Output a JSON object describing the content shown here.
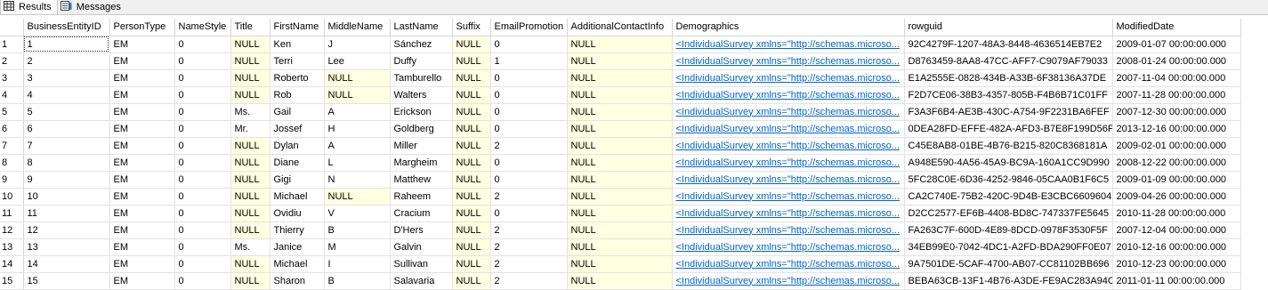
{
  "tabs": [
    {
      "label": "Results",
      "icon": "grid-icon",
      "active": true
    },
    {
      "label": "Messages",
      "icon": "messages-icon",
      "active": false
    }
  ],
  "columns": [
    "",
    "BusinessEntityID",
    "PersonType",
    "NameStyle",
    "Title",
    "FirstName",
    "MiddleName",
    "LastName",
    "Suffix",
    "EmailPromotion",
    "AdditionalContactInfo",
    "Demographics",
    "rowguid",
    "ModifiedDate"
  ],
  "null_color": "#ffffe1",
  "link_color": "#0066cc",
  "rows": [
    [
      "1",
      "1",
      "EM",
      "0",
      "NULL",
      "Ken",
      "J",
      "Sánchez",
      "NULL",
      "0",
      "NULL",
      "<IndividualSurvey xmlns=\"http://schemas.microso...",
      "92C4279F-1207-48A3-8448-4636514EB7E2",
      "2009-01-07 00:00:00.000"
    ],
    [
      "2",
      "2",
      "EM",
      "0",
      "NULL",
      "Terri",
      "Lee",
      "Duffy",
      "NULL",
      "1",
      "NULL",
      "<IndividualSurvey xmlns=\"http://schemas.microso...",
      "D8763459-8AA8-47CC-AFF7-C9079AF79033",
      "2008-01-24 00:00:00.000"
    ],
    [
      "3",
      "3",
      "EM",
      "0",
      "NULL",
      "Roberto",
      "NULL",
      "Tamburello",
      "NULL",
      "0",
      "NULL",
      "<IndividualSurvey xmlns=\"http://schemas.microso...",
      "E1A2555E-0828-434B-A33B-6F38136A37DE",
      "2007-11-04 00:00:00.000"
    ],
    [
      "4",
      "4",
      "EM",
      "0",
      "NULL",
      "Rob",
      "NULL",
      "Walters",
      "NULL",
      "0",
      "NULL",
      "<IndividualSurvey xmlns=\"http://schemas.microso...",
      "F2D7CE06-38B3-4357-805B-F4B6B71C01FF",
      "2007-11-28 00:00:00.000"
    ],
    [
      "5",
      "5",
      "EM",
      "0",
      "Ms.",
      "Gail",
      "A",
      "Erickson",
      "NULL",
      "0",
      "NULL",
      "<IndividualSurvey xmlns=\"http://schemas.microso...",
      "F3A3F6B4-AE3B-430C-A754-9F2231BA6FEF",
      "2007-12-30 00:00:00.000"
    ],
    [
      "6",
      "6",
      "EM",
      "0",
      "Mr.",
      "Jossef",
      "H",
      "Goldberg",
      "NULL",
      "0",
      "NULL",
      "<IndividualSurvey xmlns=\"http://schemas.microso...",
      "0DEA28FD-EFFE-482A-AFD3-B7E8F199D56F",
      "2013-12-16 00:00:00.000"
    ],
    [
      "7",
      "7",
      "EM",
      "0",
      "NULL",
      "Dylan",
      "A",
      "Miller",
      "NULL",
      "2",
      "NULL",
      "<IndividualSurvey xmlns=\"http://schemas.microso...",
      "C45E8AB8-01BE-4B76-B215-820C8368181A",
      "2009-02-01 00:00:00.000"
    ],
    [
      "8",
      "8",
      "EM",
      "0",
      "NULL",
      "Diane",
      "L",
      "Margheim",
      "NULL",
      "0",
      "NULL",
      "<IndividualSurvey xmlns=\"http://schemas.microso...",
      "A948E590-4A56-45A9-BC9A-160A1CC9D990",
      "2008-12-22 00:00:00.000"
    ],
    [
      "9",
      "9",
      "EM",
      "0",
      "NULL",
      "Gigi",
      "N",
      "Matthew",
      "NULL",
      "0",
      "NULL",
      "<IndividualSurvey xmlns=\"http://schemas.microso...",
      "5FC28C0E-6D36-4252-9846-05CAA0B1F6C5",
      "2009-01-09 00:00:00.000"
    ],
    [
      "10",
      "10",
      "EM",
      "0",
      "NULL",
      "Michael",
      "NULL",
      "Raheem",
      "NULL",
      "2",
      "NULL",
      "<IndividualSurvey xmlns=\"http://schemas.microso...",
      "CA2C740E-75B2-420C-9D4B-E3CBC6609604",
      "2009-04-26 00:00:00.000"
    ],
    [
      "11",
      "11",
      "EM",
      "0",
      "NULL",
      "Ovidiu",
      "V",
      "Cracium",
      "NULL",
      "0",
      "NULL",
      "<IndividualSurvey xmlns=\"http://schemas.microso...",
      "D2CC2577-EF6B-4408-BD8C-747337FE5645",
      "2010-11-28 00:00:00.000"
    ],
    [
      "12",
      "12",
      "EM",
      "0",
      "NULL",
      "Thierry",
      "B",
      "D'Hers",
      "NULL",
      "2",
      "NULL",
      "<IndividualSurvey xmlns=\"http://schemas.microso...",
      "FA263C7F-600D-4E89-8DCD-0978F3530F5F",
      "2007-12-04 00:00:00.000"
    ],
    [
      "13",
      "13",
      "EM",
      "0",
      "Ms.",
      "Janice",
      "M",
      "Galvin",
      "NULL",
      "2",
      "NULL",
      "<IndividualSurvey xmlns=\"http://schemas.microso...",
      "34EB99E0-7042-4DC1-A2FD-BDA290FF0E07",
      "2010-12-16 00:00:00.000"
    ],
    [
      "14",
      "14",
      "EM",
      "0",
      "NULL",
      "Michael",
      "I",
      "Sullivan",
      "NULL",
      "2",
      "NULL",
      "<IndividualSurvey xmlns=\"http://schemas.microso...",
      "9A7501DE-5CAF-4700-AB07-CC81102BB696",
      "2010-12-23 00:00:00.000"
    ],
    [
      "15",
      "15",
      "EM",
      "0",
      "NULL",
      "Sharon",
      "B",
      "Salavaria",
      "NULL",
      "2",
      "NULL",
      "<IndividualSurvey xmlns=\"http://schemas.microso...",
      "BEBA63CB-13F1-4B76-A3DE-FE9AC283A94C",
      "2011-01-11 00:00:00.000"
    ]
  ]
}
